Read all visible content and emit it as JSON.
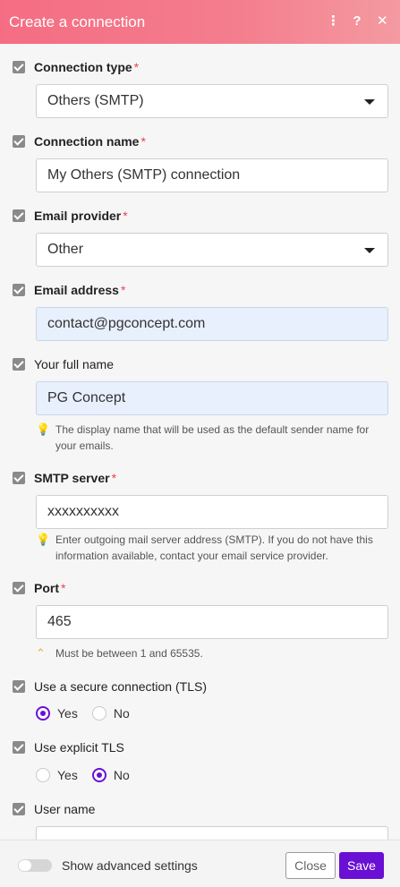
{
  "header": {
    "title": "Create a connection",
    "icons": [
      "more-vertical-icon",
      "help-icon",
      "close-icon"
    ]
  },
  "fields": {
    "connection_type": {
      "label": "Connection type",
      "required": "*",
      "value": "Others (SMTP)"
    },
    "connection_name": {
      "label": "Connection name",
      "required": "*",
      "value": "My Others (SMTP) connection"
    },
    "email_provider": {
      "label": "Email provider",
      "required": "*",
      "value": "Other"
    },
    "email_address": {
      "label": "Email address",
      "required": "*",
      "value": "contact@pgconcept.com"
    },
    "full_name": {
      "label": "Your full name",
      "value": "PG Concept",
      "hint": "The display name that will be used as the default sender name for your emails."
    },
    "smtp_server": {
      "label": "SMTP server",
      "required": "*",
      "value": "xxxxxxxxxx",
      "hint": "Enter outgoing mail server address (SMTP). If you do not have this information available, contact your email service provider."
    },
    "port": {
      "label": "Port",
      "required": "*",
      "value": "465",
      "hint": "Must be between 1 and 65535."
    },
    "secure_tls": {
      "label": "Use a secure connection (TLS)",
      "yes": "Yes",
      "no": "No",
      "selected": "Yes"
    },
    "explicit_tls": {
      "label": "Use explicit TLS",
      "yes": "Yes",
      "no": "No",
      "selected": "No"
    },
    "user_name": {
      "label": "User name",
      "value": ""
    }
  },
  "footer": {
    "advanced_label": "Show advanced settings",
    "close_label": "Close",
    "save_label": "Save"
  },
  "colors": {
    "header": "#f56d83",
    "accent": "#6a0fd4",
    "required": "#e8454f",
    "hint_icon": "#f2c230"
  }
}
